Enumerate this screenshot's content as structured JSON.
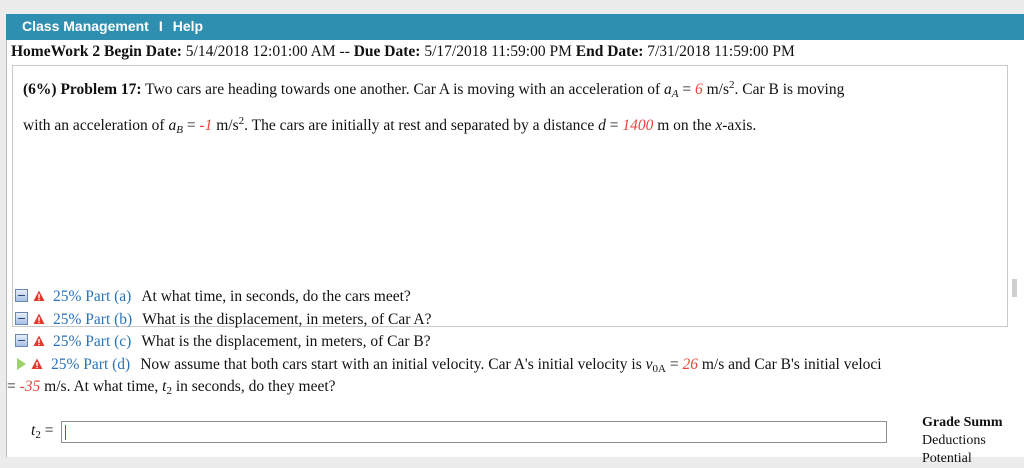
{
  "nav": {
    "class_management": "Class Management",
    "separator": "I",
    "help": "Help"
  },
  "homework": {
    "name": "HomeWork 2",
    "begin_label": "Begin Date:",
    "begin_value": "5/14/2018 12:01:00 AM",
    "dash": "--",
    "due_label": "Due Date:",
    "due_value": "5/17/2018 11:59:00 PM",
    "end_label": "End Date:",
    "end_value": "7/31/2018 11:59:00 PM"
  },
  "problem": {
    "weight": "(6%)",
    "label": "Problem 17:",
    "text_1": "Two cars are heading towards one another. Car A is moving with an acceleration of",
    "aA_symbol": "a",
    "aA_sub": "A",
    "eq": "=",
    "aA_value": "6",
    "unit_ms2": "m/s",
    "sq": "2",
    "text_2": ". Car B is moving",
    "text_3": "with an acceleration of",
    "aB_symbol": "a",
    "aB_sub": "B",
    "aB_value": "-1",
    "text_4": ". The cars are initially at rest and separated by a distance",
    "d_symbol": "d",
    "d_value": "1400",
    "text_5": "m on the",
    "x_axis": "x",
    "text_6": "-axis."
  },
  "parts": [
    {
      "pct": "25% Part (a)",
      "question": "At what time, in seconds, do the cars meet?"
    },
    {
      "pct": "25% Part (b)",
      "question": "What is the displacement, in meters, of Car A?"
    },
    {
      "pct": "25% Part (c)",
      "question": "What is the displacement, in meters, of Car B?"
    },
    {
      "pct": "25% Part (d)",
      "question": "Now assume that both cars start with an initial velocity. Car A's initial velocity is",
      "v0A_symbol": "v",
      "v0A_sub": "0A",
      "v0A_value": "26",
      "unit_ms": "m/s",
      "q_tail": "and Car B's initial veloci",
      "line2_eq": "=",
      "v0B_value": "-35",
      "line2_unit": "m/s. At what time,",
      "t2_symbol": "t",
      "t2_sub": "2",
      "line2_tail": "in seconds, do they meet?"
    }
  ],
  "answer": {
    "label_symbol": "t",
    "label_sub": "2",
    "label_eq": "=",
    "value": ""
  },
  "grade_summary": {
    "title": "Grade Summ",
    "deductions": "Deductions",
    "potential": "Potential"
  },
  "colors": {
    "nav_bg": "#2f8fb0",
    "highlight_red": "#e8453c",
    "part_blue": "#2a73b8"
  }
}
